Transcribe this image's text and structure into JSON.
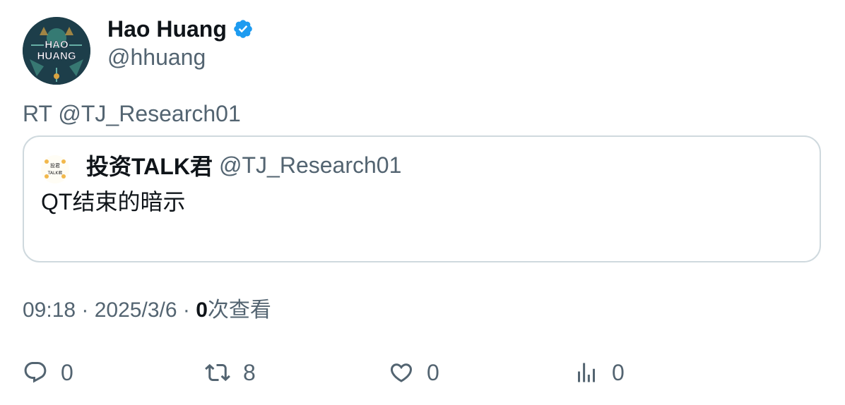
{
  "author": {
    "name": "Hao Huang",
    "handle": "@hhuang",
    "verified": true,
    "avatar_text_line1": "HAO",
    "avatar_text_line2": "HUANG"
  },
  "retweet_text": "RT @TJ_Research01",
  "quoted": {
    "name": "投资TALK君",
    "handle": "@TJ_Research01",
    "text": "QT结束的暗示",
    "avatar_text_line1": "投君",
    "avatar_text_line2": "TALK君"
  },
  "meta": {
    "time": "09:18",
    "separator": "·",
    "date": "2025/3/6",
    "views_count": "0",
    "views_label": "次查看"
  },
  "actions": {
    "reply_count": "0",
    "retweet_count": "8",
    "like_count": "0",
    "views_count": "0"
  },
  "colors": {
    "verified": "#1d9bf0",
    "text_primary": "#0f1419",
    "text_secondary": "#536471",
    "border": "#cfd9de"
  }
}
